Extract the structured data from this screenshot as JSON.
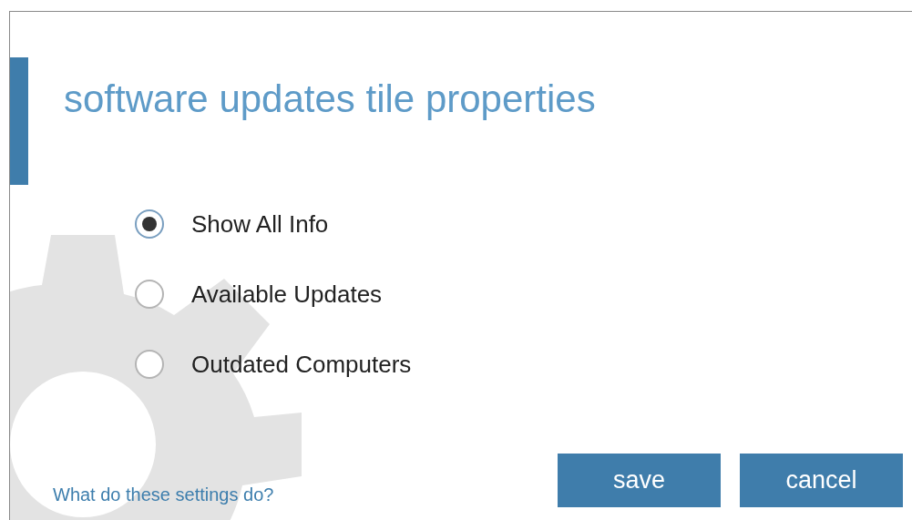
{
  "dialog": {
    "title": "software updates tile properties"
  },
  "options": [
    {
      "label": "Show All Info",
      "selected": true
    },
    {
      "label": "Available Updates",
      "selected": false
    },
    {
      "label": "Outdated Computers",
      "selected": false
    }
  ],
  "help_link": "What do these settings do?",
  "buttons": [
    {
      "label": "save"
    },
    {
      "label": "cancel"
    }
  ]
}
